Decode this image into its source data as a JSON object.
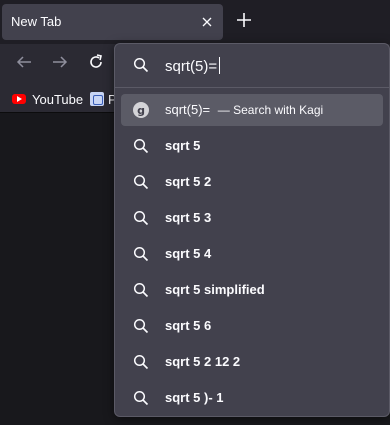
{
  "tab": {
    "title": "New Tab"
  },
  "bookmarks": [
    {
      "label": "YouTube"
    },
    {
      "label": "P"
    }
  ],
  "urlbar": {
    "value": "sqrt(5)="
  },
  "engine_row": {
    "query": "sqrt(5)=",
    "action": "— Search with Kagi",
    "icon": "kagi-icon"
  },
  "suggestions": [
    "sqrt 5",
    "sqrt 5 2",
    "sqrt 5 3",
    "sqrt 5 4",
    "sqrt 5 simplified",
    "sqrt 5 6",
    "sqrt 5 2 12 2",
    "sqrt 5 )- 1"
  ],
  "colors": {
    "tab_bg": "#42414d",
    "toolbar_bg": "#2b2a33",
    "dropdown_bg": "#42414d",
    "selected_row": "#5b5b66",
    "youtube_red": "#ff0000"
  }
}
